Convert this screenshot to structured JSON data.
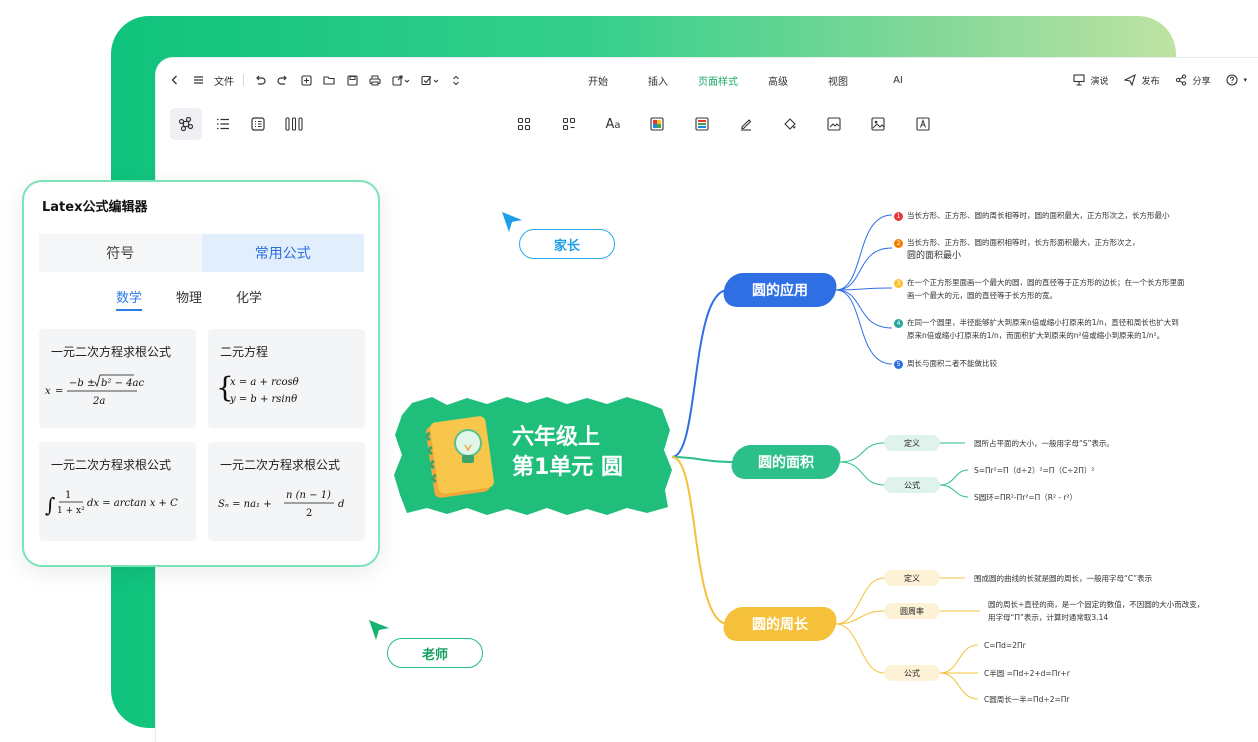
{
  "menubar": {
    "file_label": "文件",
    "tabs": [
      "开始",
      "插入",
      "页面样式",
      "高级",
      "视图",
      "AI"
    ],
    "active_tab": "页面样式",
    "present_label": "演说",
    "publish_label": "发布",
    "share_label": "分享"
  },
  "latex_panel": {
    "title": "Latex公式编辑器",
    "segments": [
      "符号",
      "常用公式"
    ],
    "selected_segment": "常用公式",
    "subtabs": [
      "数学",
      "物理",
      "化学"
    ],
    "selected_subtab": "数学",
    "cards": [
      {
        "title": "一元二次方程求根公式"
      },
      {
        "title": "二元方程"
      },
      {
        "title": "一元二次方程求根公式"
      },
      {
        "title": "一元二次方程求根公式"
      }
    ]
  },
  "cursors": {
    "parent_label": "家长",
    "teacher_label": "老师"
  },
  "mindmap": {
    "center": {
      "line1": "六年级上",
      "line2": "第1单元 圆"
    },
    "branches": [
      {
        "label": "圆的应用",
        "color": "#2f6fe4",
        "items": [
          {
            "n": "1",
            "color": "#e53935",
            "lines": [
              "当长方形、正方形、圆的周长相等时，圆的面积最大，正方形次之，长方形最小"
            ]
          },
          {
            "n": "2",
            "color": "#f57c00",
            "lines": [
              "当长方形、正方形、圆的面积相等时，长方形面积最大，正方形次之，",
              "圆的面积最小"
            ]
          },
          {
            "n": "3",
            "color": "#fbc02d",
            "lines": [
              "在一个正方形里面画一个最大的圆，圆的直径等于正方形的边长；在一个长方形里面",
              "画一个最大的元，圆的直径等于长方形的宽。"
            ]
          },
          {
            "n": "4",
            "color": "#26a69a",
            "lines": [
              "在同一个圆里，半径能够扩大到原来n倍或缩小打原来的1/n，直径和周长也扩大到",
              "原来n倍或缩小打原来的1/n，而面积扩大到原来的n²倍或缩小到原来的1/n²。"
            ]
          },
          {
            "n": "5",
            "color": "#2f6fe4",
            "lines": [
              "周长与面积二者不能做比较"
            ]
          }
        ]
      },
      {
        "label": "圆的面积",
        "color": "#2dbf8a",
        "items": [
          {
            "tag": "定义",
            "lines": [
              "圆所占平面的大小，一般用字母“S”表示。"
            ]
          },
          {
            "tag": "公式",
            "lines": [
              "S=Πr²=Π（d÷2）²=Π（C÷2Π）²",
              "S圆环=ΠR²-Πr²=Π（R² - r²）"
            ]
          }
        ]
      },
      {
        "label": "圆的周长",
        "color": "#f5c03a",
        "items": [
          {
            "tag": "定义",
            "lines": [
              "围成圆的曲线的长就是圆的周长，一般用字母“C”表示"
            ]
          },
          {
            "tag": "圆周率",
            "lines": [
              "圆的周长÷直径的商，是一个固定的数值，不因圆的大小而改变，",
              "用字母“Π”表示，计算时通常取3.14"
            ]
          },
          {
            "tag": "公式",
            "lines": [
              "C=Πd=2Πr",
              "C半圆 =Πd÷2+d=Πr+r",
              "C圆周长一半=Πd÷2=Πr"
            ]
          }
        ]
      }
    ]
  }
}
